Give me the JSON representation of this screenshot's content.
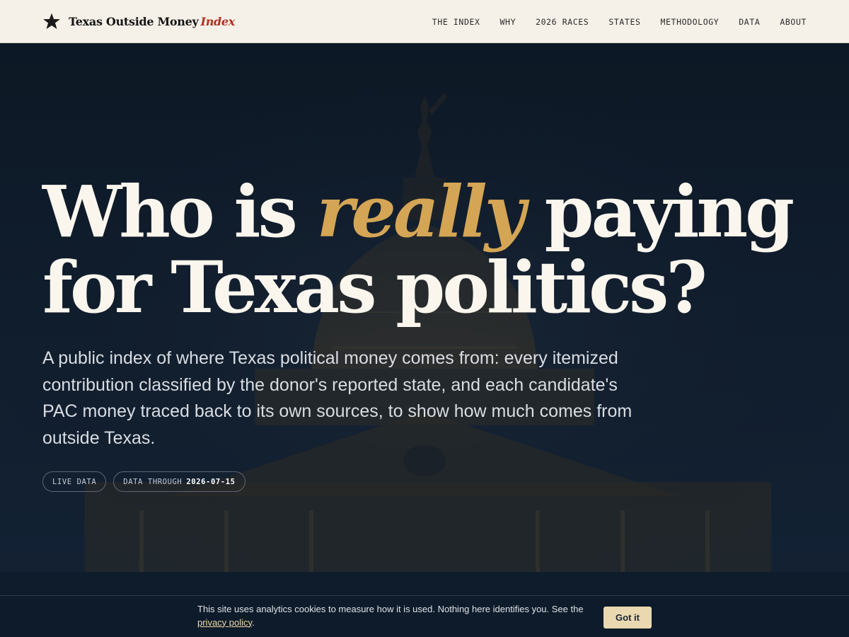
{
  "header": {
    "brand_name": "Texas Outside Money",
    "brand_accent": "Index",
    "nav": [
      {
        "label": "THE INDEX"
      },
      {
        "label": "WHY"
      },
      {
        "label": "2026 RACES"
      },
      {
        "label": "STATES"
      },
      {
        "label": "METHODOLOGY"
      },
      {
        "label": "DATA"
      },
      {
        "label": "ABOUT"
      }
    ]
  },
  "hero": {
    "title_part1": "Who is",
    "title_accent": "really",
    "title_part2": "paying for Texas politics?",
    "lede": "A public index of where Texas political money comes from: every itemized contribution classified by the donor's reported state, and each candidate's PAC money traced back to its own sources, to show how much comes from outside Texas.",
    "badges": {
      "live": "LIVE DATA",
      "through_label": "DATA THROUGH",
      "through_date": "2026-07-15"
    }
  },
  "cookie": {
    "text_before": "This site uses analytics cookies to measure how it is used. Nothing here identifies you. See the",
    "link_text": "privacy policy",
    "text_after": ".",
    "button_label": "Got it"
  },
  "colors": {
    "header_bg": "#f5f1e8",
    "hero_bg": "#111f2f",
    "accent_gold": "#d4a555",
    "brand_red": "#b3301f",
    "cookie_button": "#ead9b0"
  },
  "icons": {
    "brand": "star-icon"
  }
}
